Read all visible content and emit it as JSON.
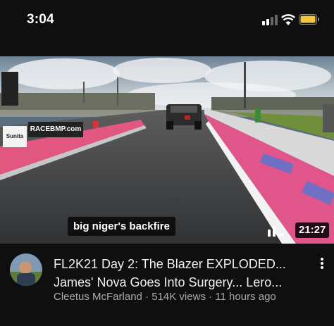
{
  "status_bar": {
    "time": "3:04",
    "icons": [
      "cellular-signal-icon",
      "wifi-icon",
      "battery-icon"
    ],
    "battery_color": "#f5c542"
  },
  "video": {
    "caption": "big niger's backfire",
    "duration": "21:27",
    "watermark_text": "RACEBMP.com",
    "sign_text": "Sunita",
    "stats_icon": "bar-chart-icon"
  },
  "video_info": {
    "title_line1": "FL2K21 Day 2: The Blazer EXPLODED...",
    "title_line2": "James' Nova Goes Into Surgery... Lero...",
    "channel": "Cleetus McFarland",
    "views": "514K views",
    "age": "11 hours ago",
    "separator": "·",
    "menu_icon": "more-vert-icon"
  }
}
